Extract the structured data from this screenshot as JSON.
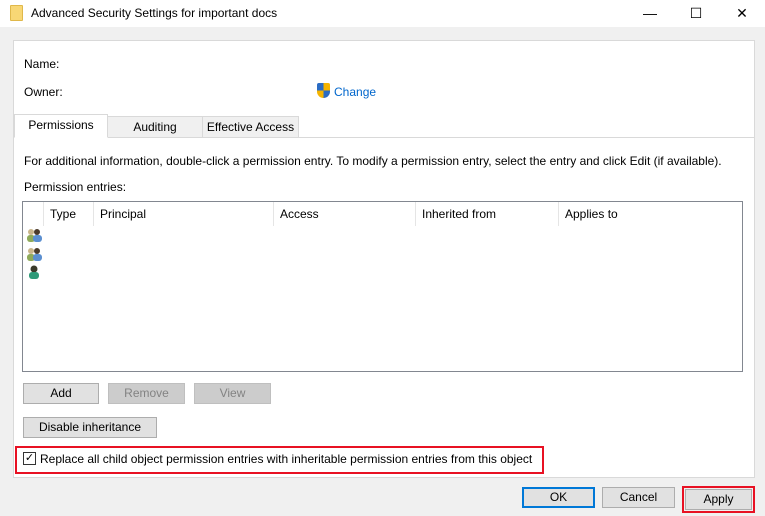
{
  "window": {
    "title": "Advanced Security Settings for important docs",
    "minimize": "—",
    "maximize": "☐",
    "close": "✕"
  },
  "header": {
    "name_label": "Name:",
    "owner_label": "Owner:",
    "change_link": "Change"
  },
  "tabs": [
    {
      "label": "Permissions",
      "active": true
    },
    {
      "label": "Auditing"
    },
    {
      "label": "Effective Access"
    }
  ],
  "permissions": {
    "info": "For additional information, double-click a permission entry. To modify a permission entry, select the entry and click Edit (if available).",
    "entries_label": "Permission entries:",
    "columns": [
      "Type",
      "Principal",
      "Access",
      "Inherited from",
      "Applies to"
    ],
    "rows": [
      {
        "icon": "user-group-icon"
      },
      {
        "icon": "user-group-icon"
      },
      {
        "icon": "user-icon"
      }
    ],
    "add": "Add",
    "remove": "Remove",
    "view": "View",
    "disable_inheritance": "Disable inheritance",
    "replace_checkbox": {
      "label": "Replace all child object permission entries with inheritable permission entries from this object",
      "checked": true,
      "mark": "✓"
    }
  },
  "footer": {
    "ok": "OK",
    "cancel": "Cancel",
    "apply": "Apply"
  },
  "colors": {
    "highlight": "#e81123",
    "link": "#0066cc",
    "focus": "#0078d7"
  }
}
